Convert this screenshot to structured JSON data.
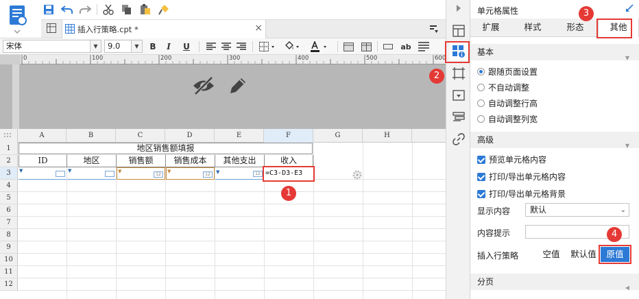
{
  "document": {
    "tab_label": "插入行策略.cpt *",
    "close": "×"
  },
  "format": {
    "font_family": "宋体",
    "font_size": "9.0",
    "bold": "B",
    "italic": "I",
    "underline": "U",
    "text_style": "ab"
  },
  "grid": {
    "columns": [
      "A",
      "B",
      "C",
      "D",
      "E",
      "F",
      "G",
      "H"
    ],
    "rows": [
      "1",
      "2",
      "3",
      "4",
      "5",
      "6",
      "7",
      "8",
      "9",
      "10",
      "11",
      "12"
    ],
    "title": "地区销售额填报",
    "headers": [
      "ID",
      "地区",
      "销售额",
      "销售成本",
      "其他支出",
      "收入"
    ],
    "formula": "=C3-D3-E3",
    "mini_label": "12"
  },
  "callouts": [
    "1",
    "2",
    "3",
    "4"
  ],
  "panel": {
    "title": "单元格属性",
    "tabs": [
      "扩展",
      "样式",
      "形态",
      "其他"
    ],
    "basic": {
      "heading": "基本",
      "options": [
        "跟随页面设置",
        "不自动调整",
        "自动调整行高",
        "自动调整列宽"
      ]
    },
    "advanced": {
      "heading": "高级",
      "checks": [
        "预览单元格内容",
        "打印/导出单元格内容",
        "打印/导出单元格背景"
      ],
      "display_label": "显示内容",
      "display_value": "默认",
      "tooltip_label": "内容提示",
      "insert_label": "插入行策略",
      "insert_options": [
        "空值",
        "默认值",
        "原值"
      ]
    },
    "paging_heading": "分页"
  },
  "colors": {
    "accent": "#2d7ad6",
    "highlight": "#e53935"
  }
}
